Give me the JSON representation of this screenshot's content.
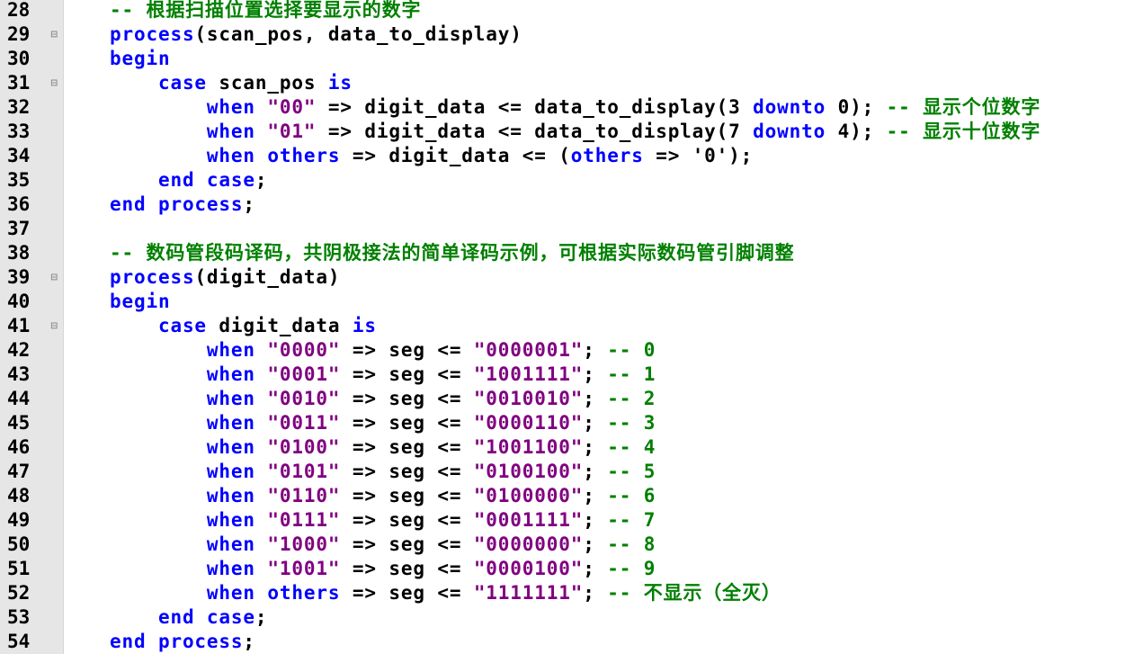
{
  "editor": {
    "language": "VHDL",
    "colors": {
      "keyword": "#0000ff",
      "string": "#800080",
      "comment": "#008000",
      "text": "#000000",
      "gutter": "#e6e6e6"
    },
    "lines": [
      {
        "n": "28",
        "fold": "",
        "tokens": [
          {
            "t": "    ",
            "c": "pl"
          },
          {
            "t": "-- 根据扫描位置选择要显示的数字",
            "c": "cm"
          }
        ]
      },
      {
        "n": "29",
        "fold": "minus-box-icon",
        "tokens": [
          {
            "t": "    ",
            "c": "pl"
          },
          {
            "t": "process",
            "c": "kw"
          },
          {
            "t": "(scan_pos, data_to_display)",
            "c": "pl"
          }
        ]
      },
      {
        "n": "30",
        "fold": "",
        "tokens": [
          {
            "t": "    ",
            "c": "pl"
          },
          {
            "t": "begin",
            "c": "kw"
          }
        ]
      },
      {
        "n": "31",
        "fold": "minus-box-icon",
        "tokens": [
          {
            "t": "        ",
            "c": "pl"
          },
          {
            "t": "case",
            "c": "kw"
          },
          {
            "t": " scan_pos ",
            "c": "pl"
          },
          {
            "t": "is",
            "c": "kw"
          }
        ]
      },
      {
        "n": "32",
        "fold": "",
        "tokens": [
          {
            "t": "            ",
            "c": "pl"
          },
          {
            "t": "when",
            "c": "kw"
          },
          {
            "t": " ",
            "c": "pl"
          },
          {
            "t": "\"00\"",
            "c": "str"
          },
          {
            "t": " => digit_data <= data_to_display(3 ",
            "c": "pl"
          },
          {
            "t": "downto",
            "c": "kw"
          },
          {
            "t": " 0); ",
            "c": "pl"
          },
          {
            "t": "-- 显示个位数字",
            "c": "cm"
          }
        ]
      },
      {
        "n": "33",
        "fold": "",
        "tokens": [
          {
            "t": "            ",
            "c": "pl"
          },
          {
            "t": "when",
            "c": "kw"
          },
          {
            "t": " ",
            "c": "pl"
          },
          {
            "t": "\"01\"",
            "c": "str"
          },
          {
            "t": " => digit_data <= data_to_display(7 ",
            "c": "pl"
          },
          {
            "t": "downto",
            "c": "kw"
          },
          {
            "t": " 4); ",
            "c": "pl"
          },
          {
            "t": "-- 显示十位数字",
            "c": "cm"
          }
        ]
      },
      {
        "n": "34",
        "fold": "",
        "tokens": [
          {
            "t": "            ",
            "c": "pl"
          },
          {
            "t": "when",
            "c": "kw"
          },
          {
            "t": " ",
            "c": "pl"
          },
          {
            "t": "others",
            "c": "kw"
          },
          {
            "t": " => digit_data <= (",
            "c": "pl"
          },
          {
            "t": "others",
            "c": "kw"
          },
          {
            "t": " => '0');",
            "c": "pl"
          }
        ]
      },
      {
        "n": "35",
        "fold": "",
        "tokens": [
          {
            "t": "        ",
            "c": "pl"
          },
          {
            "t": "end case",
            "c": "kw"
          },
          {
            "t": ";",
            "c": "pl"
          }
        ]
      },
      {
        "n": "36",
        "fold": "",
        "tokens": [
          {
            "t": "    ",
            "c": "pl"
          },
          {
            "t": "end process",
            "c": "kw"
          },
          {
            "t": ";",
            "c": "pl"
          }
        ]
      },
      {
        "n": "37",
        "fold": "",
        "tokens": []
      },
      {
        "n": "38",
        "fold": "",
        "tokens": [
          {
            "t": "    ",
            "c": "pl"
          },
          {
            "t": "-- 数码管段码译码，共阴极接法的简单译码示例，可根据实际数码管引脚调整",
            "c": "cm"
          }
        ]
      },
      {
        "n": "39",
        "fold": "minus-box-icon",
        "tokens": [
          {
            "t": "    ",
            "c": "pl"
          },
          {
            "t": "process",
            "c": "kw"
          },
          {
            "t": "(digit_data)",
            "c": "pl"
          }
        ]
      },
      {
        "n": "40",
        "fold": "",
        "tokens": [
          {
            "t": "    ",
            "c": "pl"
          },
          {
            "t": "begin",
            "c": "kw"
          }
        ]
      },
      {
        "n": "41",
        "fold": "minus-box-icon",
        "tokens": [
          {
            "t": "        ",
            "c": "pl"
          },
          {
            "t": "case",
            "c": "kw"
          },
          {
            "t": " digit_data ",
            "c": "pl"
          },
          {
            "t": "is",
            "c": "kw"
          }
        ]
      },
      {
        "n": "42",
        "fold": "",
        "tokens": [
          {
            "t": "            ",
            "c": "pl"
          },
          {
            "t": "when",
            "c": "kw"
          },
          {
            "t": " ",
            "c": "pl"
          },
          {
            "t": "\"0000\"",
            "c": "str"
          },
          {
            "t": " => seg <= ",
            "c": "pl"
          },
          {
            "t": "\"0000001\"",
            "c": "str"
          },
          {
            "t": "; ",
            "c": "pl"
          },
          {
            "t": "-- 0",
            "c": "cm"
          }
        ]
      },
      {
        "n": "43",
        "fold": "",
        "tokens": [
          {
            "t": "            ",
            "c": "pl"
          },
          {
            "t": "when",
            "c": "kw"
          },
          {
            "t": " ",
            "c": "pl"
          },
          {
            "t": "\"0001\"",
            "c": "str"
          },
          {
            "t": " => seg <= ",
            "c": "pl"
          },
          {
            "t": "\"1001111\"",
            "c": "str"
          },
          {
            "t": "; ",
            "c": "pl"
          },
          {
            "t": "-- 1",
            "c": "cm"
          }
        ]
      },
      {
        "n": "44",
        "fold": "",
        "tokens": [
          {
            "t": "            ",
            "c": "pl"
          },
          {
            "t": "when",
            "c": "kw"
          },
          {
            "t": " ",
            "c": "pl"
          },
          {
            "t": "\"0010\"",
            "c": "str"
          },
          {
            "t": " => seg <= ",
            "c": "pl"
          },
          {
            "t": "\"0010010\"",
            "c": "str"
          },
          {
            "t": "; ",
            "c": "pl"
          },
          {
            "t": "-- 2",
            "c": "cm"
          }
        ]
      },
      {
        "n": "45",
        "fold": "",
        "tokens": [
          {
            "t": "            ",
            "c": "pl"
          },
          {
            "t": "when",
            "c": "kw"
          },
          {
            "t": " ",
            "c": "pl"
          },
          {
            "t": "\"0011\"",
            "c": "str"
          },
          {
            "t": " => seg <= ",
            "c": "pl"
          },
          {
            "t": "\"0000110\"",
            "c": "str"
          },
          {
            "t": "; ",
            "c": "pl"
          },
          {
            "t": "-- 3",
            "c": "cm"
          }
        ]
      },
      {
        "n": "46",
        "fold": "",
        "tokens": [
          {
            "t": "            ",
            "c": "pl"
          },
          {
            "t": "when",
            "c": "kw"
          },
          {
            "t": " ",
            "c": "pl"
          },
          {
            "t": "\"0100\"",
            "c": "str"
          },
          {
            "t": " => seg <= ",
            "c": "pl"
          },
          {
            "t": "\"1001100\"",
            "c": "str"
          },
          {
            "t": "; ",
            "c": "pl"
          },
          {
            "t": "-- 4",
            "c": "cm"
          }
        ]
      },
      {
        "n": "47",
        "fold": "",
        "tokens": [
          {
            "t": "            ",
            "c": "pl"
          },
          {
            "t": "when",
            "c": "kw"
          },
          {
            "t": " ",
            "c": "pl"
          },
          {
            "t": "\"0101\"",
            "c": "str"
          },
          {
            "t": " => seg <= ",
            "c": "pl"
          },
          {
            "t": "\"0100100\"",
            "c": "str"
          },
          {
            "t": "; ",
            "c": "pl"
          },
          {
            "t": "-- 5",
            "c": "cm"
          }
        ]
      },
      {
        "n": "48",
        "fold": "",
        "tokens": [
          {
            "t": "            ",
            "c": "pl"
          },
          {
            "t": "when",
            "c": "kw"
          },
          {
            "t": " ",
            "c": "pl"
          },
          {
            "t": "\"0110\"",
            "c": "str"
          },
          {
            "t": " => seg <= ",
            "c": "pl"
          },
          {
            "t": "\"0100000\"",
            "c": "str"
          },
          {
            "t": "; ",
            "c": "pl"
          },
          {
            "t": "-- 6",
            "c": "cm"
          }
        ]
      },
      {
        "n": "49",
        "fold": "",
        "tokens": [
          {
            "t": "            ",
            "c": "pl"
          },
          {
            "t": "when",
            "c": "kw"
          },
          {
            "t": " ",
            "c": "pl"
          },
          {
            "t": "\"0111\"",
            "c": "str"
          },
          {
            "t": " => seg <= ",
            "c": "pl"
          },
          {
            "t": "\"0001111\"",
            "c": "str"
          },
          {
            "t": "; ",
            "c": "pl"
          },
          {
            "t": "-- 7",
            "c": "cm"
          }
        ]
      },
      {
        "n": "50",
        "fold": "",
        "tokens": [
          {
            "t": "            ",
            "c": "pl"
          },
          {
            "t": "when",
            "c": "kw"
          },
          {
            "t": " ",
            "c": "pl"
          },
          {
            "t": "\"1000\"",
            "c": "str"
          },
          {
            "t": " => seg <= ",
            "c": "pl"
          },
          {
            "t": "\"0000000\"",
            "c": "str"
          },
          {
            "t": "; ",
            "c": "pl"
          },
          {
            "t": "-- 8",
            "c": "cm"
          }
        ]
      },
      {
        "n": "51",
        "fold": "",
        "tokens": [
          {
            "t": "            ",
            "c": "pl"
          },
          {
            "t": "when",
            "c": "kw"
          },
          {
            "t": " ",
            "c": "pl"
          },
          {
            "t": "\"1001\"",
            "c": "str"
          },
          {
            "t": " => seg <= ",
            "c": "pl"
          },
          {
            "t": "\"0000100\"",
            "c": "str"
          },
          {
            "t": "; ",
            "c": "pl"
          },
          {
            "t": "-- 9",
            "c": "cm"
          }
        ]
      },
      {
        "n": "52",
        "fold": "",
        "tokens": [
          {
            "t": "            ",
            "c": "pl"
          },
          {
            "t": "when",
            "c": "kw"
          },
          {
            "t": " ",
            "c": "pl"
          },
          {
            "t": "others",
            "c": "kw"
          },
          {
            "t": " => seg <= ",
            "c": "pl"
          },
          {
            "t": "\"1111111\"",
            "c": "str"
          },
          {
            "t": "; ",
            "c": "pl"
          },
          {
            "t": "-- 不显示（全灭）",
            "c": "cm"
          }
        ]
      },
      {
        "n": "53",
        "fold": "",
        "tokens": [
          {
            "t": "        ",
            "c": "pl"
          },
          {
            "t": "end case",
            "c": "kw"
          },
          {
            "t": ";",
            "c": "pl"
          }
        ]
      },
      {
        "n": "54",
        "fold": "",
        "tokens": [
          {
            "t": "    ",
            "c": "pl"
          },
          {
            "t": "end process",
            "c": "kw"
          },
          {
            "t": ";",
            "c": "pl"
          }
        ]
      }
    ]
  }
}
